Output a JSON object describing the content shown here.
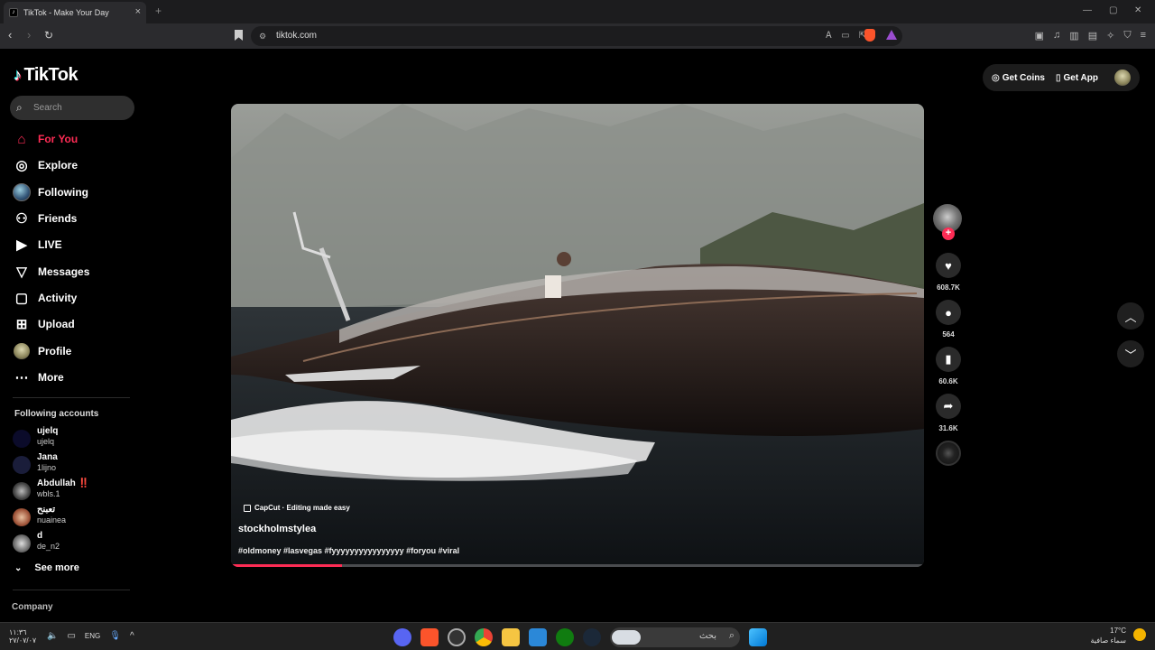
{
  "browser": {
    "tab_title": "TikTok - Make Your Day",
    "url": "tiktok.com",
    "tab_close": "×",
    "new_tab": "+",
    "minimize": "—",
    "maximize": "▢",
    "close": "✕"
  },
  "sidebar": {
    "logo": "TikTok",
    "search_placeholder": "Search",
    "nav": [
      {
        "label": "For You",
        "icon": "home-icon",
        "active": true
      },
      {
        "label": "Explore",
        "icon": "compass-icon"
      },
      {
        "label": "Following",
        "icon": "following-avatar"
      },
      {
        "label": "Friends",
        "icon": "friends-icon"
      },
      {
        "label": "LIVE",
        "icon": "live-icon"
      },
      {
        "label": "Messages",
        "icon": "messages-icon"
      },
      {
        "label": "Activity",
        "icon": "activity-icon"
      },
      {
        "label": "Upload",
        "icon": "upload-icon"
      },
      {
        "label": "Profile",
        "icon": "profile-avatar"
      },
      {
        "label": "More",
        "icon": "more-icon"
      }
    ],
    "following_accounts_title": "Following accounts",
    "accounts": [
      {
        "name": "ujelq",
        "handle": "ujelq"
      },
      {
        "name": "Jana",
        "handle": "1lijno"
      },
      {
        "name": "Abdullah ‼️",
        "handle": "wbls.1"
      },
      {
        "name": "تعبنح",
        "handle": "nuainea"
      },
      {
        "name": "d",
        "handle": "de_n2"
      }
    ],
    "see_more": "See more",
    "company": "Company"
  },
  "header": {
    "get_coins": "Get Coins",
    "get_app": "Get App"
  },
  "video": {
    "capcut_label": "CapCut · Editing made easy",
    "author": "stockholmstylea",
    "hashtags": "#oldmoney #lasvegas #fyyyyyyyyyyyyyyyy #foryou #viral",
    "progress": 0.16
  },
  "actions": {
    "likes": "608.7K",
    "comments": "564",
    "saves": "60.6K",
    "shares": "31.6K"
  },
  "taskbar": {
    "time": "١١:٣٦",
    "date": "٢٧/٠٧/٠٧",
    "lang": "ENG",
    "search_label": "بحث",
    "temp": "17°C",
    "weather": "سماء صافية"
  },
  "colors": {
    "accent": "#fe2c55",
    "background": "#000000"
  }
}
